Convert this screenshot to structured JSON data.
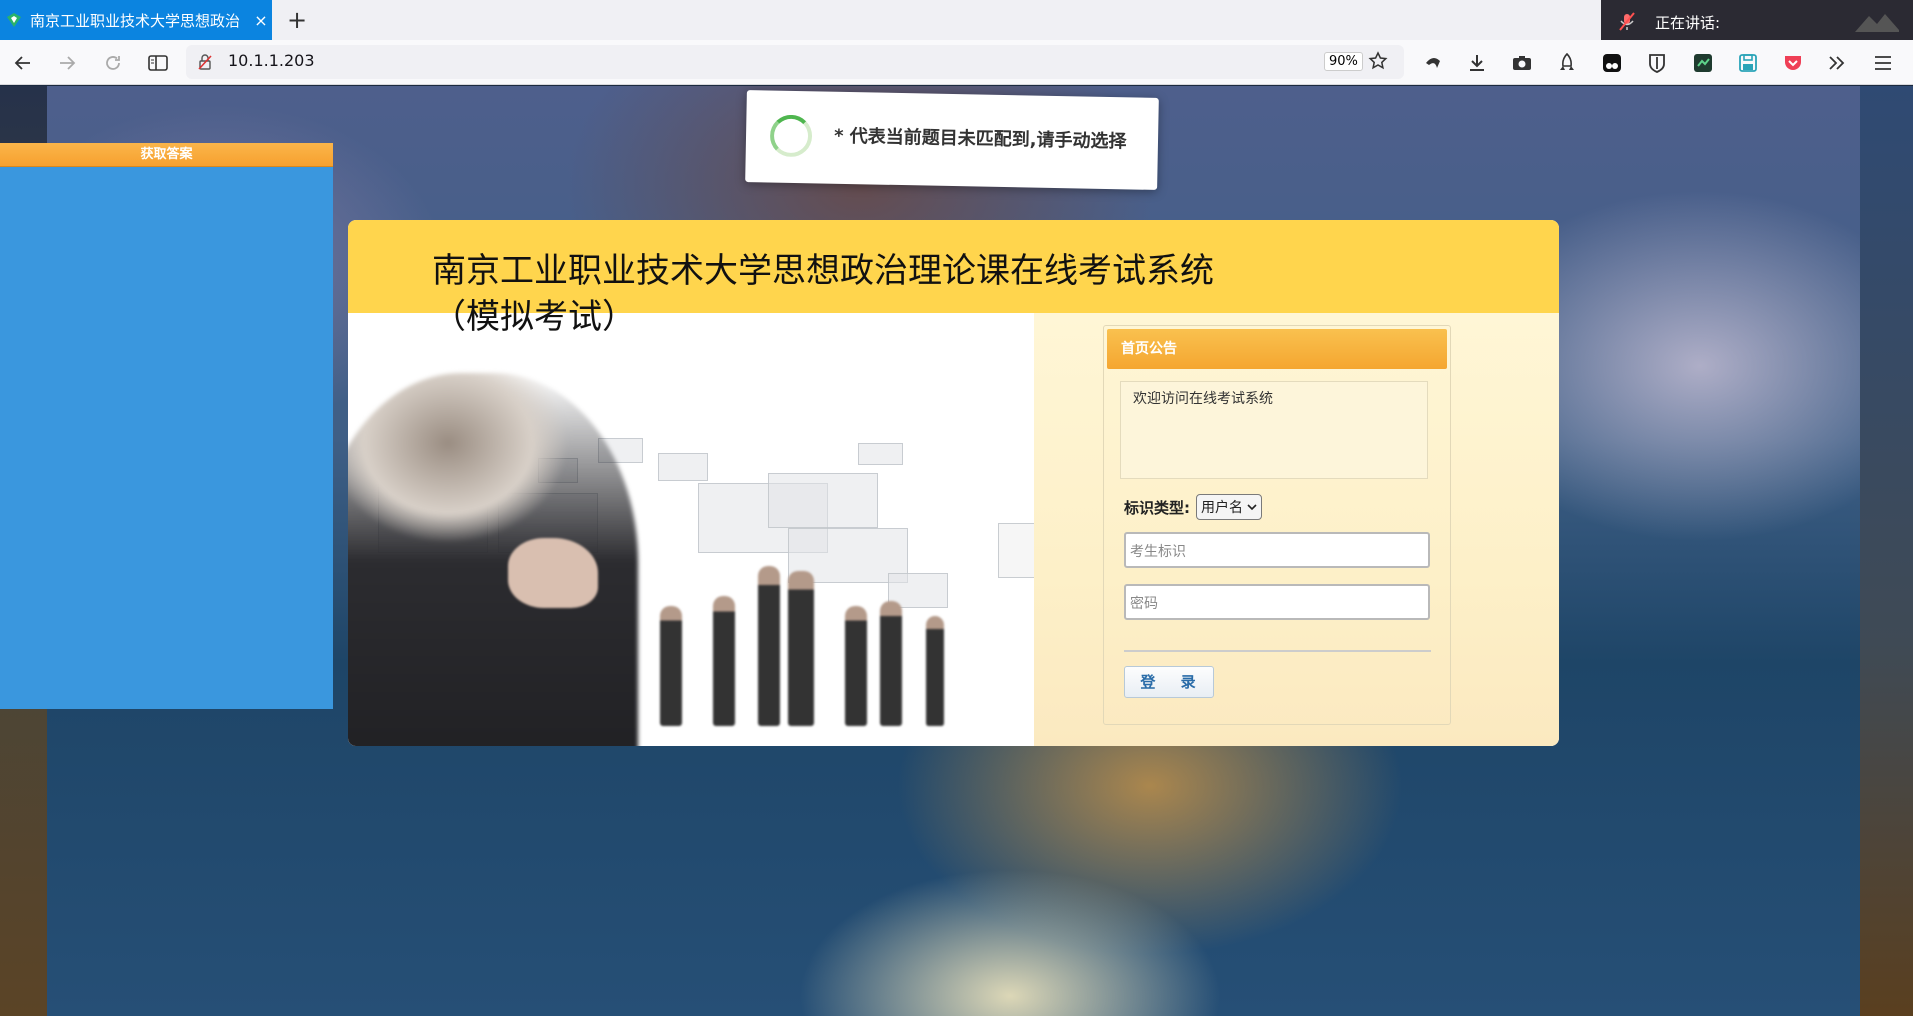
{
  "browser": {
    "tab_title": "南京工业职业技术大学思想政治",
    "tab_close": "×",
    "new_tab": "+",
    "url": "10.1.1.203",
    "zoom": "90%",
    "speaking_label": "正在讲话:"
  },
  "sidebar_panel": {
    "title": "获取答案"
  },
  "toast": {
    "message": "* 代表当前题目未匹配到,请手动选择"
  },
  "header": {
    "title_line1": "南京工业职业技术大学思想政治理论课在线考试系统",
    "title_line2": "（模拟考试）"
  },
  "notice": {
    "title": "首页公告",
    "body": "欢迎访问在线考试系统"
  },
  "login": {
    "id_type_label": "标识类型:",
    "id_type_value": "用户名",
    "username_placeholder": "考生标识",
    "password_placeholder": "密码",
    "submit_label": "登 录"
  },
  "colors": {
    "tab_active": "#0b84e0",
    "header_yellow": "#ffd54d",
    "panel_blue": "#3a97de",
    "notice_orange": "#f5a630"
  }
}
